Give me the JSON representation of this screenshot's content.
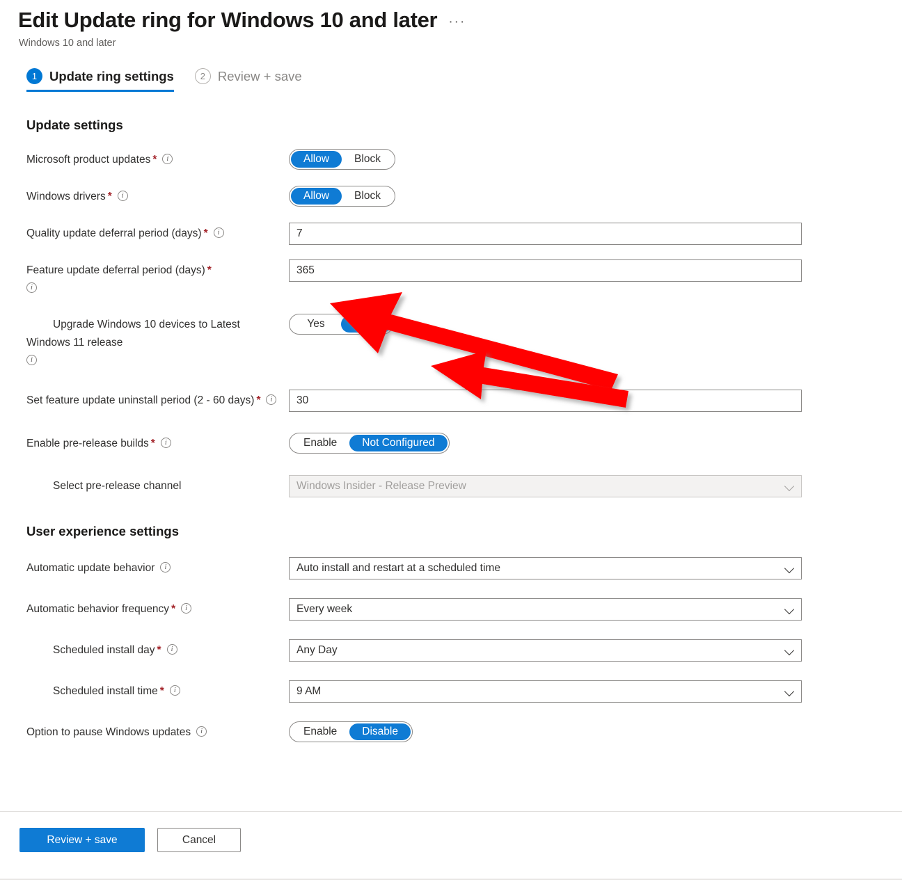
{
  "header": {
    "title": "Edit Update ring for Windows 10 and later",
    "subtitle": "Windows 10 and later",
    "more_options": "···"
  },
  "wizard": {
    "steps": [
      {
        "num": "1",
        "label": "Update ring settings",
        "active": true
      },
      {
        "num": "2",
        "label": "Review + save",
        "active": false
      }
    ]
  },
  "sections": {
    "update_settings": "Update settings",
    "user_experience_settings": "User experience settings"
  },
  "fields": {
    "microsoft_product_updates": {
      "label": "Microsoft product updates",
      "required": "*",
      "options": [
        "Allow",
        "Block"
      ],
      "value": "Allow"
    },
    "windows_drivers": {
      "label": "Windows drivers",
      "required": "*",
      "options": [
        "Allow",
        "Block"
      ],
      "value": "Allow"
    },
    "quality_update_deferral": {
      "label": "Quality update deferral period (days)",
      "required": "*",
      "value": "7"
    },
    "feature_update_deferral": {
      "label": "Feature update deferral period (days)",
      "required": "*",
      "value": "365"
    },
    "upgrade_to_win11": {
      "label": "Upgrade Windows 10 devices to Latest Windows 11 release",
      "options": [
        "Yes",
        "No"
      ],
      "value": "No"
    },
    "feature_update_uninstall": {
      "label": "Set feature update uninstall period (2 - 60 days)",
      "required": "*",
      "value": "30"
    },
    "enable_prerelease_builds": {
      "label": "Enable pre-release builds",
      "required": "*",
      "options": [
        "Enable",
        "Not Configured"
      ],
      "value": "Not Configured"
    },
    "prerelease_channel": {
      "label": "Select pre-release channel",
      "value": "Windows Insider - Release Preview",
      "disabled": true
    },
    "automatic_update_behavior": {
      "label": "Automatic update behavior",
      "value": "Auto install and restart at a scheduled time"
    },
    "automatic_behavior_frequency": {
      "label": "Automatic behavior frequency",
      "required": "*",
      "value": "Every week"
    },
    "scheduled_install_day": {
      "label": "Scheduled install day",
      "required": "*",
      "value": "Any Day"
    },
    "scheduled_install_time": {
      "label": "Scheduled install time",
      "required": "*",
      "value": "9 AM"
    },
    "pause_windows_updates": {
      "label": "Option to pause Windows updates",
      "options": [
        "Enable",
        "Disable"
      ],
      "value": "Disable"
    }
  },
  "footer": {
    "primary": "Review + save",
    "secondary": "Cancel"
  },
  "annotations": {
    "arrow_color": "#ff0000",
    "arrows": [
      {
        "name": "arrow-pointing-to-feature-deferral-value",
        "target": "feature_update_deferral"
      },
      {
        "name": "arrow-pointing-to-upgrade-toggle",
        "target": "upgrade_to_win11"
      }
    ]
  },
  "colors": {
    "accent_blue": "#0078d4",
    "toggle_blue": "#0f7bd4",
    "required_red": "#a4262c",
    "annotation_red": "#ff0000"
  }
}
